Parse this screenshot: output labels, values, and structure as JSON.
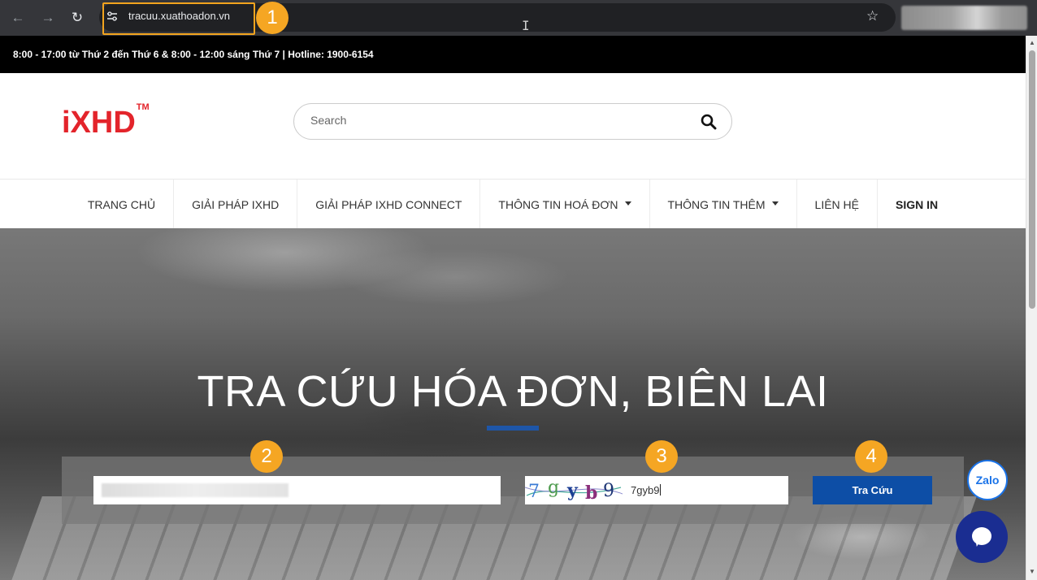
{
  "browser": {
    "url": "tracuu.xuathoadon.vn",
    "back_icon": "arrow-left",
    "forward_icon": "arrow-right",
    "reload_icon": "reload"
  },
  "annotations": {
    "step1": "1",
    "step2": "2",
    "step3": "3",
    "step4": "4",
    "color": "#f5a623"
  },
  "topbar": {
    "text": "8:00 - 17:00 từ Thứ 2 đến Thứ 6 & 8:00 - 12:00 sáng Thứ 7   |  Hotline: 1900-6154"
  },
  "header": {
    "logo": "iXHD",
    "logo_tm": "TM",
    "search_placeholder": "Search",
    "brand_color": "#e3242b"
  },
  "menu": {
    "items": [
      {
        "label": "TRANG CHỦ"
      },
      {
        "label": "GIẢI PHÁP IXHD"
      },
      {
        "label": "GIẢI PHÁP IXHD CONNECT"
      },
      {
        "label": "THÔNG TIN HOÁ ĐƠN",
        "dropdown": true
      },
      {
        "label": "THÔNG TIN THÊM",
        "dropdown": true
      },
      {
        "label": "LIÊN HỆ"
      },
      {
        "label": "SIGN IN"
      }
    ]
  },
  "hero": {
    "title": "TRA CỨU HÓA ĐƠN, BIÊN LAI",
    "accent_color": "#1e56a8"
  },
  "form": {
    "captcha_text": "7gyb9",
    "captcha_value": "7gyb9",
    "submit_label": "Tra Cứu",
    "button_color": "#0d4ea6"
  },
  "widgets": {
    "zalo_label": "Zalo"
  }
}
